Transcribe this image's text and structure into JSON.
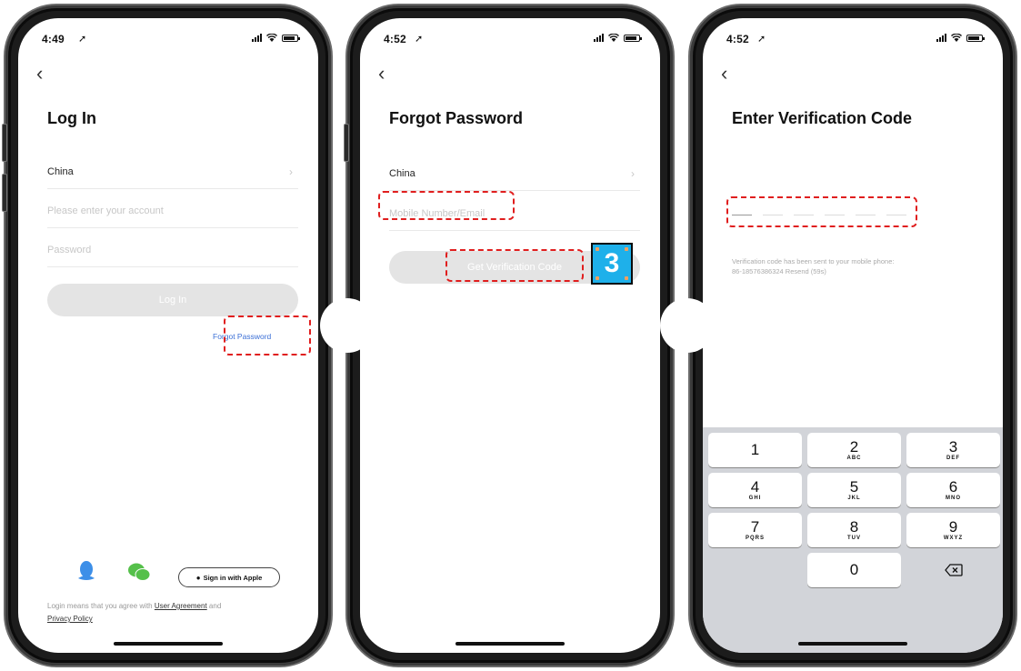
{
  "screens": [
    {
      "status_time": "4:49",
      "title": "Log In",
      "region": "China",
      "account_placeholder": "Please enter your account",
      "password_placeholder": "Password",
      "login_button": "Log In",
      "forgot_password_link": "Forgot Password",
      "apple_button": "Sign in with Apple",
      "agree_prefix": "Login means that you agree with",
      "user_agreement": "User Agreement",
      "agree_and": "and",
      "privacy_policy": "Privacy Policy"
    },
    {
      "status_time": "4:52",
      "title": "Forgot Password",
      "region": "China",
      "mobile_placeholder": "Mobile Number/Email",
      "get_code_button": "Get Verification Code",
      "step_badge": "3"
    },
    {
      "status_time": "4:52",
      "title": "Enter Verification Code",
      "sent_message_line1": "Verification code has been sent to your mobile phone:",
      "sent_message_line2": "86-18576386324  Resend (59s)"
    }
  ],
  "keypad": {
    "keys": [
      {
        "num": "1",
        "letters": ""
      },
      {
        "num": "2",
        "letters": "ABC"
      },
      {
        "num": "3",
        "letters": "DEF"
      },
      {
        "num": "4",
        "letters": "GHI"
      },
      {
        "num": "5",
        "letters": "JKL"
      },
      {
        "num": "6",
        "letters": "MNO"
      },
      {
        "num": "7",
        "letters": "PQRS"
      },
      {
        "num": "8",
        "letters": "TUV"
      },
      {
        "num": "9",
        "letters": "WXYZ"
      },
      {
        "num": "0",
        "letters": ""
      }
    ]
  },
  "icons": {
    "back": "chevron-left-icon",
    "region_chevron": "chevron-right-icon",
    "qq": "qq-icon",
    "wechat": "wechat-icon",
    "apple": "apple-icon",
    "delete": "backspace-icon"
  },
  "colors": {
    "annotation": "#e01e1e",
    "link": "#3b6fd6",
    "badge": "#1eb0ea",
    "qq": "#3d8fe8",
    "wechat": "#55c04a"
  }
}
